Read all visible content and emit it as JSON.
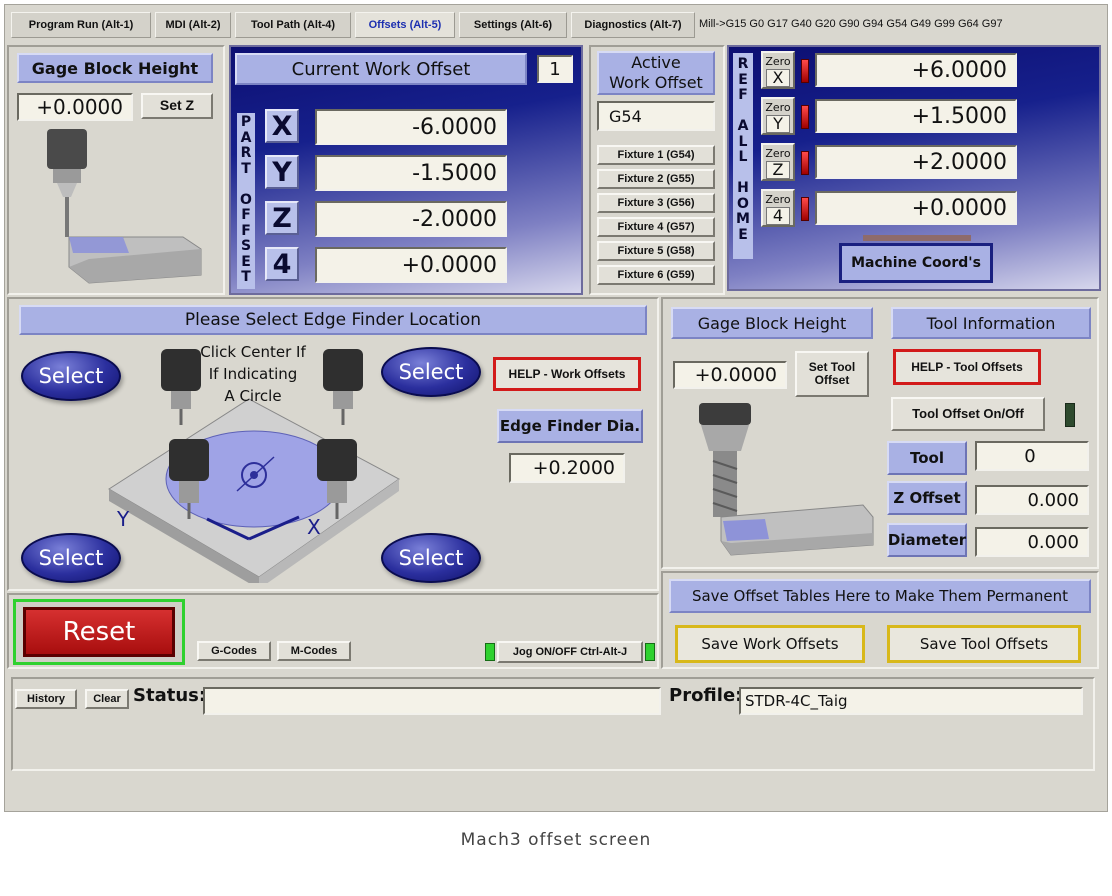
{
  "tabs": [
    {
      "label": "Program Run (Alt-1)"
    },
    {
      "label": "MDI (Alt-2)"
    },
    {
      "label": "Tool Path (Alt-4)"
    },
    {
      "label": "Offsets (Alt-5)"
    },
    {
      "label": "Settings (Alt-6)"
    },
    {
      "label": "Diagnostics (Alt-7)"
    }
  ],
  "modal_line": "Mill->G15  G0 G17 G40 G20 G90 G94 G54 G49 G99 G64 G97",
  "gage_top": {
    "title": "Gage Block Height",
    "value": "+0.0000",
    "set_z": "Set Z"
  },
  "current_offset": {
    "title": "Current Work Offset",
    "number": "1",
    "side_label": "PART OFFSET",
    "axes": [
      {
        "letter": "X",
        "value": "-6.0000"
      },
      {
        "letter": "Y",
        "value": "-1.5000"
      },
      {
        "letter": "Z",
        "value": "-2.0000"
      },
      {
        "letter": "4",
        "value": "+0.0000"
      }
    ]
  },
  "active_offset": {
    "title_line1": "Active",
    "title_line2": "Work Offset",
    "value": "G54",
    "fixtures": [
      "Fixture 1 (G54)",
      "Fixture 2 (G55)",
      "Fixture 3 (G56)",
      "Fixture 4 (G57)",
      "Fixture 5 (G58)",
      "Fixture 6 (G59)"
    ]
  },
  "machine": {
    "side_label": "REF ALL HOME",
    "zero_label": "Zero",
    "axes": [
      {
        "letter": "X",
        "value": "+6.0000"
      },
      {
        "letter": "Y",
        "value": "+1.5000"
      },
      {
        "letter": "Z",
        "value": "+2.0000"
      },
      {
        "letter": "4",
        "value": "+0.0000"
      }
    ],
    "coords_button": "Machine Coord's"
  },
  "edge_finder": {
    "title": "Please Select Edge Finder Location",
    "select_label": "Select",
    "hint": [
      "Click Center If",
      "If Indicating",
      "A Circle"
    ],
    "axis_y": "Y",
    "axis_x": "X",
    "help_button": "HELP - Work Offsets",
    "dia_label": "Edge Finder Dia.",
    "dia_value": "+0.2000"
  },
  "tool_panel": {
    "gage_title": "Gage Block Height",
    "gage_value": "+0.0000",
    "set_tool_offset": "Set Tool Offset",
    "info_title": "Tool Information",
    "help_button": "HELP - Tool Offsets",
    "onoff_button": "Tool Offset On/Off",
    "rows": [
      {
        "label": "Tool",
        "value": "0"
      },
      {
        "label": "Z Offset",
        "value": "0.000"
      },
      {
        "label": "Diameter",
        "value": "0.000"
      }
    ]
  },
  "save_panel": {
    "title": "Save Offset Tables Here to Make Them Permanent",
    "save_work": "Save Work Offsets",
    "save_tool": "Save Tool Offsets"
  },
  "bottom": {
    "reset": "Reset",
    "gcodes": "G-Codes",
    "mcodes": "M-Codes",
    "jog": "Jog ON/OFF Ctrl-Alt-J"
  },
  "status_bar": {
    "history": "History",
    "clear": "Clear",
    "status_label": "Status:",
    "status_value": "",
    "profile_label": "Profile:",
    "profile_value": "STDR-4C_Taig"
  },
  "caption": "Mach3 offset screen",
  "colors": {
    "blue_panel": "#16208c",
    "header": "#a9b1e4",
    "reset_red": "#c81a1a",
    "led_green": "#2fd12f"
  }
}
